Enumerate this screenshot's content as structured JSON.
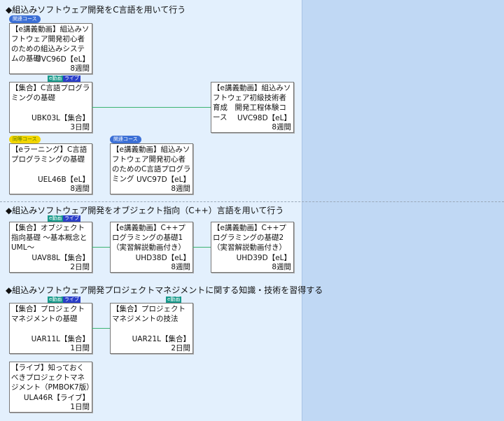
{
  "colors": {
    "related": "#3b6fd6",
    "equivalent": "#f2d600",
    "e_video": "#16998a",
    "live": "#2a3ec8",
    "connector": "#3cb371"
  },
  "sections": [
    {
      "title": "◆組込みソフトウェア開発をC言語を用いて行う",
      "cards": [
        {
          "title": "【e講義動画】組込みソフトウェア開発初心者のための組込みシステムの基礎",
          "code": "UVC96D【eL】",
          "duration": "8週間",
          "badge": "関連コース"
        },
        {
          "title": "【集合】C言語プログラミングの基礎",
          "code": "UBK03L【集合】",
          "duration": "3日間",
          "tags": [
            "e動画",
            "ライブ"
          ]
        },
        {
          "title": "【e講義動画】組込みソフトウェア初級技術者育成　開発工程体験コース",
          "code": "UVC98D【eL】",
          "duration": "8週間"
        },
        {
          "title": "【eラーニング】C言語プログラミングの基礎",
          "code": "UEL46B【eL】",
          "duration": "8週間",
          "badge": "同等コース"
        },
        {
          "title": "【e講義動画】組込みソフトウェア開発初心者のためのC言語プログラミング",
          "code": "UVC97D【eL】",
          "duration": "8週間",
          "badge": "関連コース"
        }
      ]
    },
    {
      "title": "◆組込みソフトウェア開発をオブジェクト指向（C++）言語を用いて行う",
      "cards": [
        {
          "title": "【集合】オブジェクト指向基礎 ～基本概念とUML～",
          "code": "UAV88L【集合】",
          "duration": "2日間",
          "tags": [
            "e動画",
            "ライブ"
          ]
        },
        {
          "title": "【e講義動画】C++プログラミングの基礎1（実習解説動画付き）",
          "code": "UHD38D【eL】",
          "duration": "8週間"
        },
        {
          "title": "【e講義動画】C++プログラミングの基礎2（実習解説動画付き）",
          "code": "UHD39D【eL】",
          "duration": "8週間"
        }
      ]
    },
    {
      "title": "◆組込みソフトウェア開発プロジェクトマネジメントに関する知識・技術を習得する",
      "cards": [
        {
          "title": "【集合】プロジェクトマネジメントの基礎",
          "code": "UAR11L【集合】",
          "duration": "1日間",
          "tags": [
            "e動画",
            "ライブ"
          ]
        },
        {
          "title": "【集合】プロジェクトマネジメントの技法",
          "code": "UAR21L【集合】",
          "duration": "2日間",
          "tags": [
            "e動画"
          ]
        },
        {
          "title": "【ライブ】知っておくべきプロジェクトマネジメント（PMBOK7版）",
          "code": "ULA46R【ライブ】",
          "duration": "1日間"
        }
      ]
    }
  ]
}
